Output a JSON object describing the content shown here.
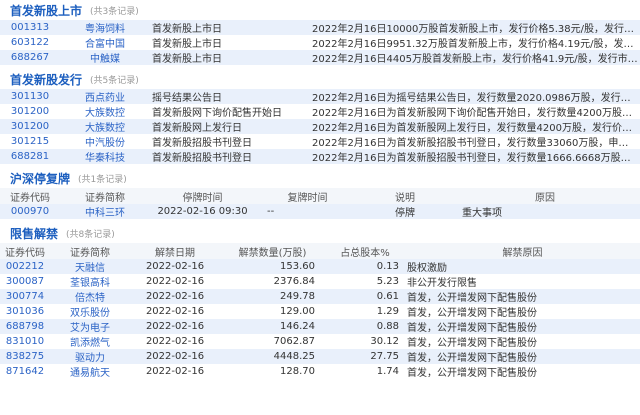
{
  "listing": {
    "title": "首发新股上市",
    "count": "(共3条记录)",
    "rows": [
      {
        "code": "001313",
        "name": "粤海饲料",
        "event": "首发新股上市日",
        "detail": "2022年2月16日10000万股首发新股上市，发行价格5.38元/股，发行市盈率..."
      },
      {
        "code": "603122",
        "name": "合富中国",
        "event": "首发新股上市日",
        "detail": "2022年2月16日9951.32万股首发新股上市，发行价格4.19元/股，发行市盈..."
      },
      {
        "code": "688267",
        "name": "中触媒",
        "event": "首发新股上市日",
        "detail": "2022年2月16日4405万股首发新股上市，发行价格41.9元/股，发行市盈率8..."
      }
    ]
  },
  "issue": {
    "title": "首发新股发行",
    "count": "(共5条记录)",
    "rows": [
      {
        "code": "301130",
        "name": "西点药业",
        "event": "摇号结果公告日",
        "detail": "2022年2月16日为摇号结果公告日，发行数量2020.0986万股，发行价格22..."
      },
      {
        "code": "301200",
        "name": "大族数控",
        "event": "首发新股网下询价配售开始日",
        "detail": "2022年2月16日为首发新股网下询价配售开始日，发行数量4200万股，发..."
      },
      {
        "code": "301200",
        "name": "大族数控",
        "event": "首发新股网上发行日",
        "detail": "2022年2月16日为首发新股网上发行日，发行数量4200万股，发行价格76.5..."
      },
      {
        "code": "301215",
        "name": "中汽股份",
        "event": "首发新股招股书刊登日",
        "detail": "2022年2月16日为首发新股招股书刊登日，发行数量33060万股，申购代码..."
      },
      {
        "code": "688281",
        "name": "华秦科技",
        "event": "首发新股招股书刊登日",
        "detail": "2022年2月16日为首发新股招股书刊登日，发行数量1666.6668万股，申购..."
      }
    ]
  },
  "suspend": {
    "title": "沪深停复牌",
    "count": "(共1条记录)",
    "headers": [
      "证券代码",
      "证券简称",
      "停牌时间",
      "复牌时间",
      "说明",
      "原因"
    ],
    "rows": [
      {
        "code": "000970",
        "name": "中科三环",
        "stop": "2022-02-16 09:30",
        "resume": "--",
        "desc": "停牌",
        "reason": "重大事项"
      }
    ]
  },
  "unlock": {
    "title": "限售解禁",
    "count": "(共8条记录)",
    "headers": [
      "证券代码",
      "证券简称",
      "解禁日期",
      "解禁数量(万股)",
      "占总股本%",
      "解禁原因"
    ],
    "rows": [
      {
        "code": "002212",
        "name": "天融信",
        "date": "2022-02-16",
        "qty": "153.60",
        "pct": "0.13",
        "reason": "股权激励"
      },
      {
        "code": "300087",
        "name": "荃银高科",
        "date": "2022-02-16",
        "qty": "2376.84",
        "pct": "5.23",
        "reason": "非公开发行限售"
      },
      {
        "code": "300774",
        "name": "倍杰特",
        "date": "2022-02-16",
        "qty": "249.78",
        "pct": "0.61",
        "reason": "首发，公开增发网下配售股份"
      },
      {
        "code": "301036",
        "name": "双乐股份",
        "date": "2022-02-16",
        "qty": "129.00",
        "pct": "1.29",
        "reason": "首发，公开增发网下配售股份"
      },
      {
        "code": "688798",
        "name": "艾为电子",
        "date": "2022-02-16",
        "qty": "146.24",
        "pct": "0.88",
        "reason": "首发，公开增发网下配售股份"
      },
      {
        "code": "831010",
        "name": "凯添燃气",
        "date": "2022-02-16",
        "qty": "7062.87",
        "pct": "30.12",
        "reason": "首发，公开增发网下配售股份"
      },
      {
        "code": "838275",
        "name": "驱动力",
        "date": "2022-02-16",
        "qty": "4448.25",
        "pct": "27.75",
        "reason": "首发，公开增发网下配售股份"
      },
      {
        "code": "871642",
        "name": "通易航天",
        "date": "2022-02-16",
        "qty": "128.70",
        "pct": "1.74",
        "reason": "首发，公开增发网下配售股份"
      }
    ]
  }
}
